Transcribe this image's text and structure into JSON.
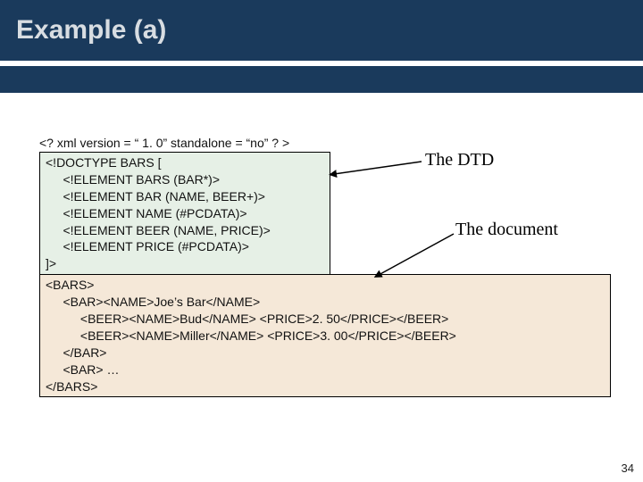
{
  "title": "Example (a)",
  "xml_declaration": "<? xml version = “ 1. 0” standalone = “no” ? >",
  "dtd_lines": [
    "<!DOCTYPE BARS [",
    "     <!ELEMENT BARS (BAR*)>",
    "     <!ELEMENT BAR (NAME, BEER+)>",
    "     <!ELEMENT NAME (#PCDATA)>",
    "     <!ELEMENT BEER (NAME, PRICE)>",
    "     <!ELEMENT PRICE (#PCDATA)>",
    "]>"
  ],
  "doc_lines": [
    "<BARS>",
    "     <BAR><NAME>Joe’s Bar</NAME>",
    "          <BEER><NAME>Bud</NAME> <PRICE>2. 50</PRICE></BEER>",
    "          <BEER><NAME>Miller</NAME> <PRICE>3. 00</PRICE></BEER>",
    "     </BAR>",
    "     <BAR> …",
    "</BARS>"
  ],
  "labels": {
    "dtd": "The DTD",
    "document": "The document"
  },
  "page_number": "34"
}
